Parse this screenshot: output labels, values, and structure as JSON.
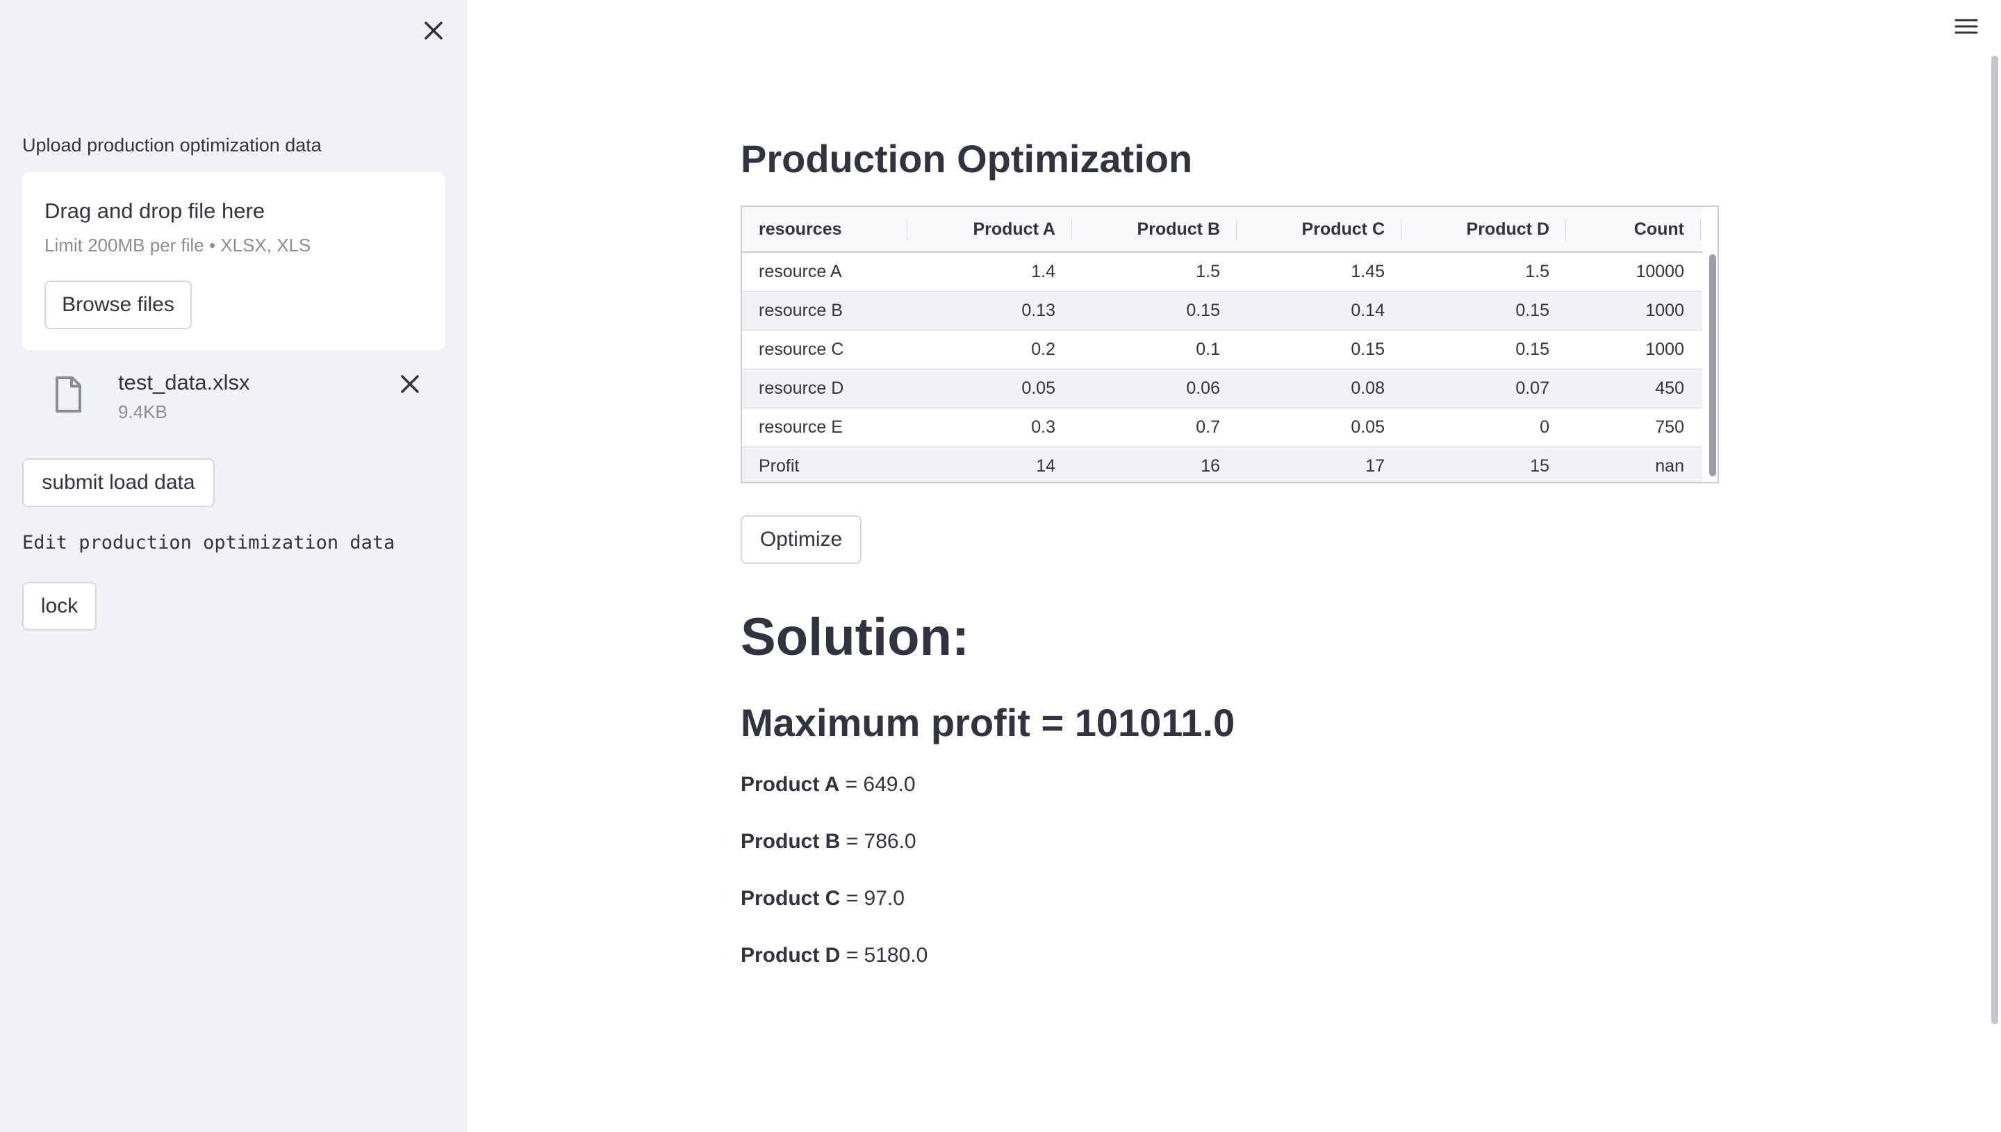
{
  "sidebar": {
    "upload_label": "Upload production optimization data",
    "dropzone": {
      "title": "Drag and drop file here",
      "limit": "Limit 200MB per file • XLSX, XLS",
      "browse_label": "Browse files"
    },
    "file": {
      "name": "test_data.xlsx",
      "size": "9.4KB"
    },
    "submit_label": "submit load data",
    "edit_label": "Edit production optimization data",
    "lock_label": "lock"
  },
  "main": {
    "title": "Production Optimization",
    "table": {
      "headers": [
        "resources",
        "Product A",
        "Product B",
        "Product C",
        "Product D",
        "Count"
      ],
      "rows": [
        [
          "resource A",
          "1.4",
          "1.5",
          "1.45",
          "1.5",
          "10000"
        ],
        [
          "resource B",
          "0.13",
          "0.15",
          "0.14",
          "0.15",
          "1000"
        ],
        [
          "resource C",
          "0.2",
          "0.1",
          "0.15",
          "0.15",
          "1000"
        ],
        [
          "resource D",
          "0.05",
          "0.06",
          "0.08",
          "0.07",
          "450"
        ],
        [
          "resource E",
          "0.3",
          "0.7",
          "0.05",
          "0",
          "750"
        ],
        [
          "Profit",
          "14",
          "16",
          "17",
          "15",
          "nan"
        ]
      ]
    },
    "optimize_label": "Optimize",
    "solution_title": "Solution:",
    "max_profit": "Maximum profit = 101011.0",
    "products": [
      {
        "name": "Product A",
        "value": "= 649.0"
      },
      {
        "name": "Product B",
        "value": "= 786.0"
      },
      {
        "name": "Product C",
        "value": "= 97.0"
      },
      {
        "name": "Product D",
        "value": "= 5180.0"
      }
    ]
  }
}
